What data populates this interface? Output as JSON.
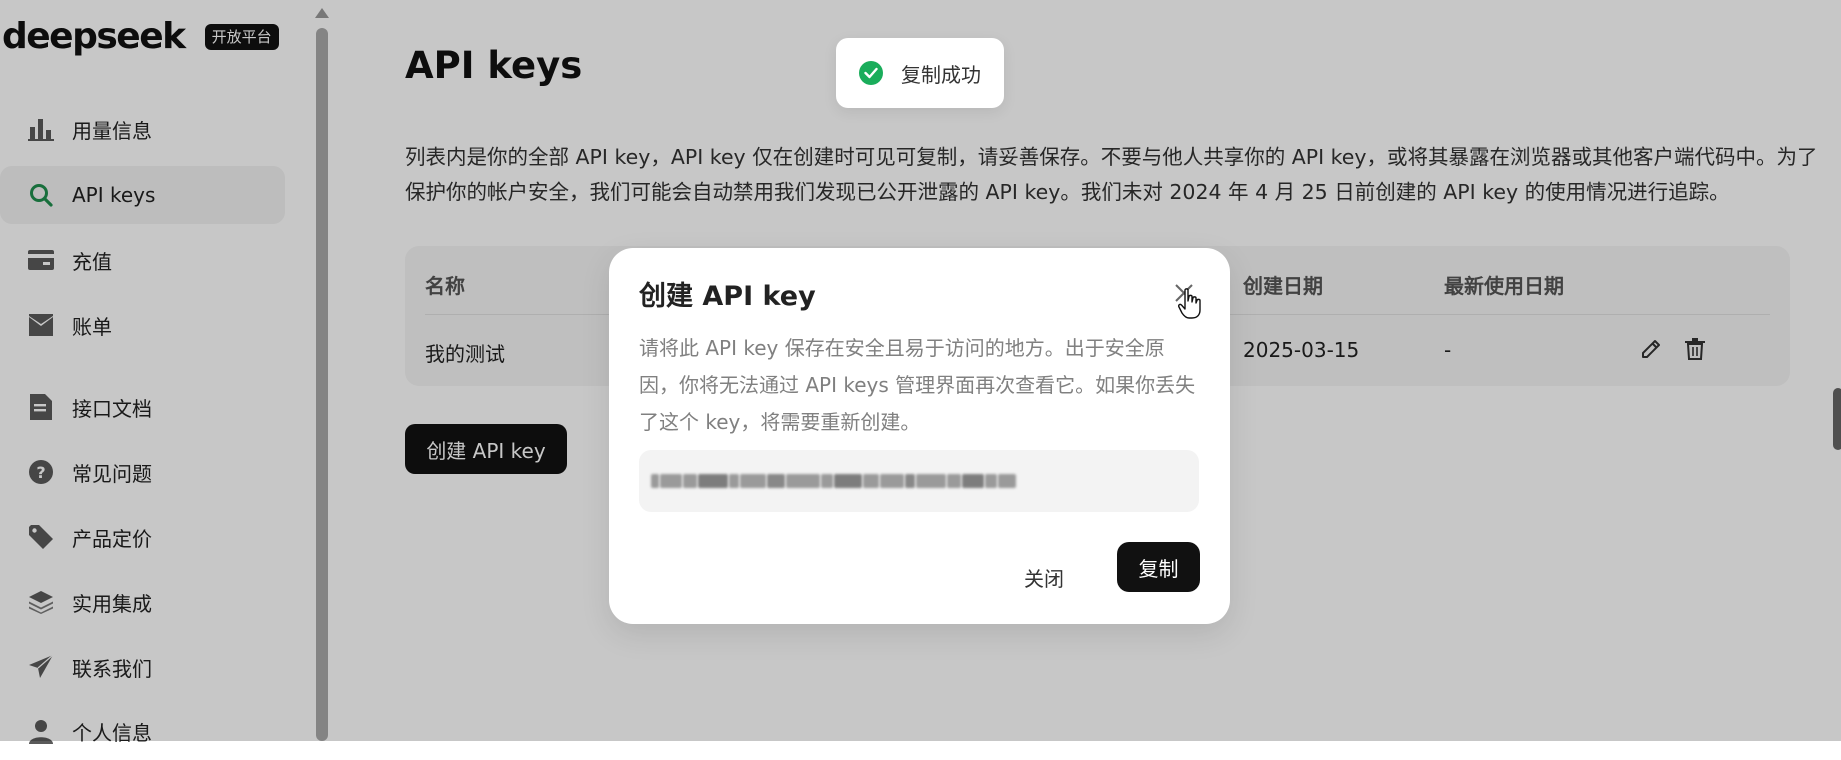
{
  "brand": {
    "name": "deepseek",
    "badge": "开放平台"
  },
  "sidebar": {
    "items": [
      {
        "label": "用量信息",
        "icon": "bar-chart-icon"
      },
      {
        "label": "API keys",
        "icon": "search-icon",
        "active": true
      },
      {
        "label": "充值",
        "icon": "card-icon"
      },
      {
        "label": "账单",
        "icon": "inbox-icon"
      },
      {
        "label": "接口文档",
        "icon": "document-icon"
      },
      {
        "label": "常见问题",
        "icon": "question-icon"
      },
      {
        "label": "产品定价",
        "icon": "tag-icon"
      },
      {
        "label": "实用集成",
        "icon": "layers-icon"
      },
      {
        "label": "联系我们",
        "icon": "send-icon"
      },
      {
        "label": "个人信息",
        "icon": "user-icon"
      }
    ]
  },
  "main": {
    "title": "API keys",
    "description": "列表内是你的全部 API key，API key 仅在创建时可见可复制，请妥善保存。不要与他人共享你的 API key，或将其暴露在浏览器或其他客户端代码中。为了保护你的帐户安全，我们可能会自动禁用我们发现已公开泄露的 API key。我们未对 2024 年 4 月 25 日前创建的 API key 的使用情况进行追踪。",
    "table": {
      "headers": {
        "name": "名称",
        "created": "创建日期",
        "last_used": "最新使用日期"
      },
      "rows": [
        {
          "name": "我的测试",
          "created": "2025-03-15",
          "last_used": "-"
        }
      ]
    },
    "create_button": "创建 API key"
  },
  "toast": {
    "text": "复制成功",
    "color": "#1aad5b"
  },
  "modal": {
    "title": "创建 API key",
    "description": "请将此 API key 保存在安全且易于访问的地方。出于安全原因，你将无法通过 API keys 管理界面再次查看它。如果你丢失了这个 key，将需要重新创建。",
    "close_label": "关闭",
    "copy_label": "复制"
  }
}
